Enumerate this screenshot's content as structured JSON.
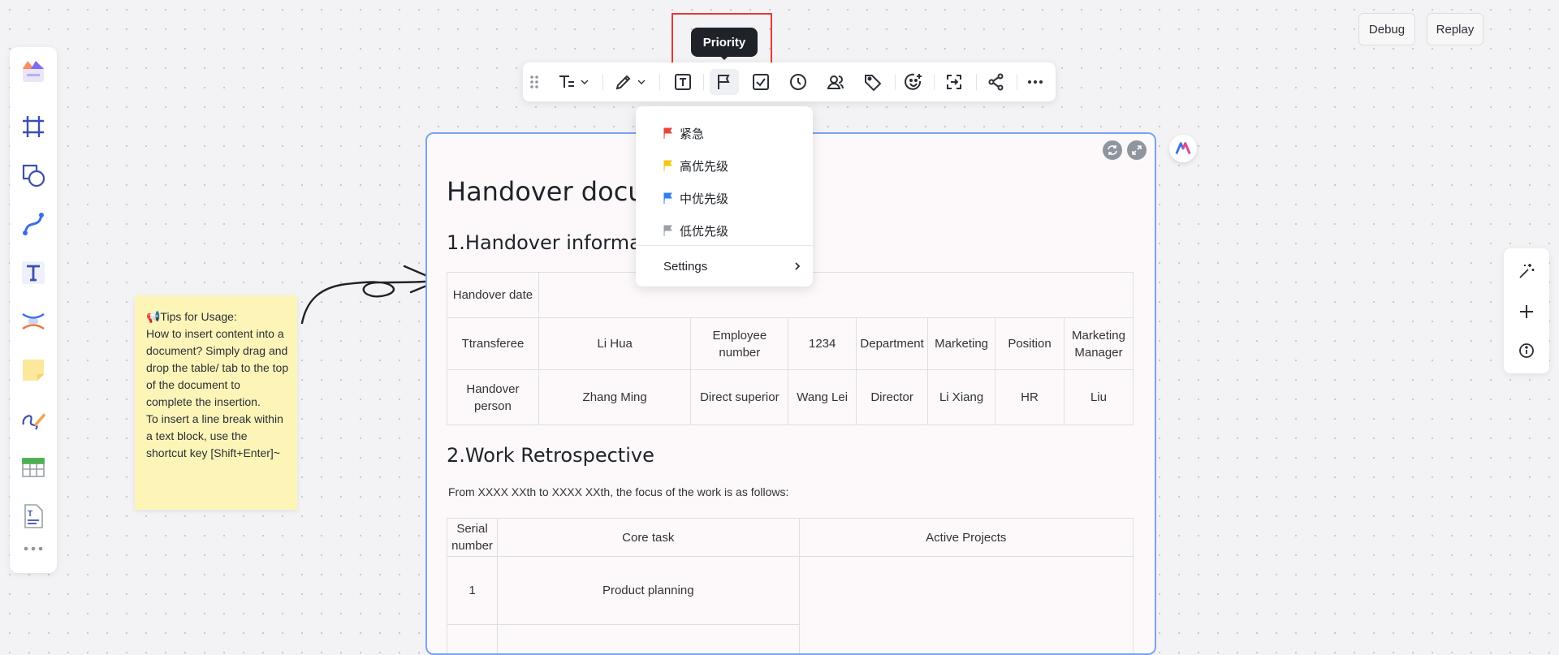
{
  "top_right": {
    "debug_label": "Debug",
    "replay_label": "Replay"
  },
  "tooltip": {
    "text": "Priority"
  },
  "toolbar": {
    "items": [
      "drag-handle-icon",
      "text-style-icon",
      "highlighter-icon",
      "text-box-icon",
      "flag-icon",
      "checkbox-icon",
      "clock-icon",
      "people-icon",
      "tag-icon",
      "emoji-add-icon",
      "convert-icon",
      "connect-icon",
      "more-icon"
    ]
  },
  "priority_menu": {
    "items": [
      {
        "label": "紧急",
        "color": "#e8463a"
      },
      {
        "label": "高优先级",
        "color": "#f5c518"
      },
      {
        "label": "中优先级",
        "color": "#2f7ff0"
      },
      {
        "label": "低优先级",
        "color": "#9aa0a6"
      }
    ],
    "settings_label": "Settings"
  },
  "doc": {
    "title": "Handover docum",
    "section1": "1.Handover informatio",
    "table1": {
      "row1": [
        "Handover date",
        ""
      ],
      "row2": [
        "Ttransferee",
        "Li Hua",
        "Employee number",
        "1234",
        "Department",
        "Marketing",
        "Position",
        "Marketing Manager"
      ],
      "row3": [
        "Handover person",
        "Zhang Ming",
        "Direct superior",
        "Wang Lei",
        "Director",
        "Li Xiang",
        "HR",
        "Liu"
      ]
    },
    "section2": "2.Work Retrospective",
    "para": "From XXXX XXth to XXXX XXth, the focus of the work is as follows:",
    "table2": {
      "headers": [
        "Serial number",
        "Core task",
        "Active Projects"
      ],
      "rows": [
        [
          "1",
          "Product planning",
          ""
        ]
      ]
    }
  },
  "sticky_note": {
    "text": "📢Tips for Usage:\nHow to insert content into a document? Simply drag and drop the table/ tab to the top of the document to complete the insertion.\nTo insert a line break within a text block, use the shortcut key [Shift+Enter]~"
  },
  "colors": {
    "accent": "#7aa2f7",
    "sticky": "#fdf5b8",
    "highlight": "#e53935"
  }
}
